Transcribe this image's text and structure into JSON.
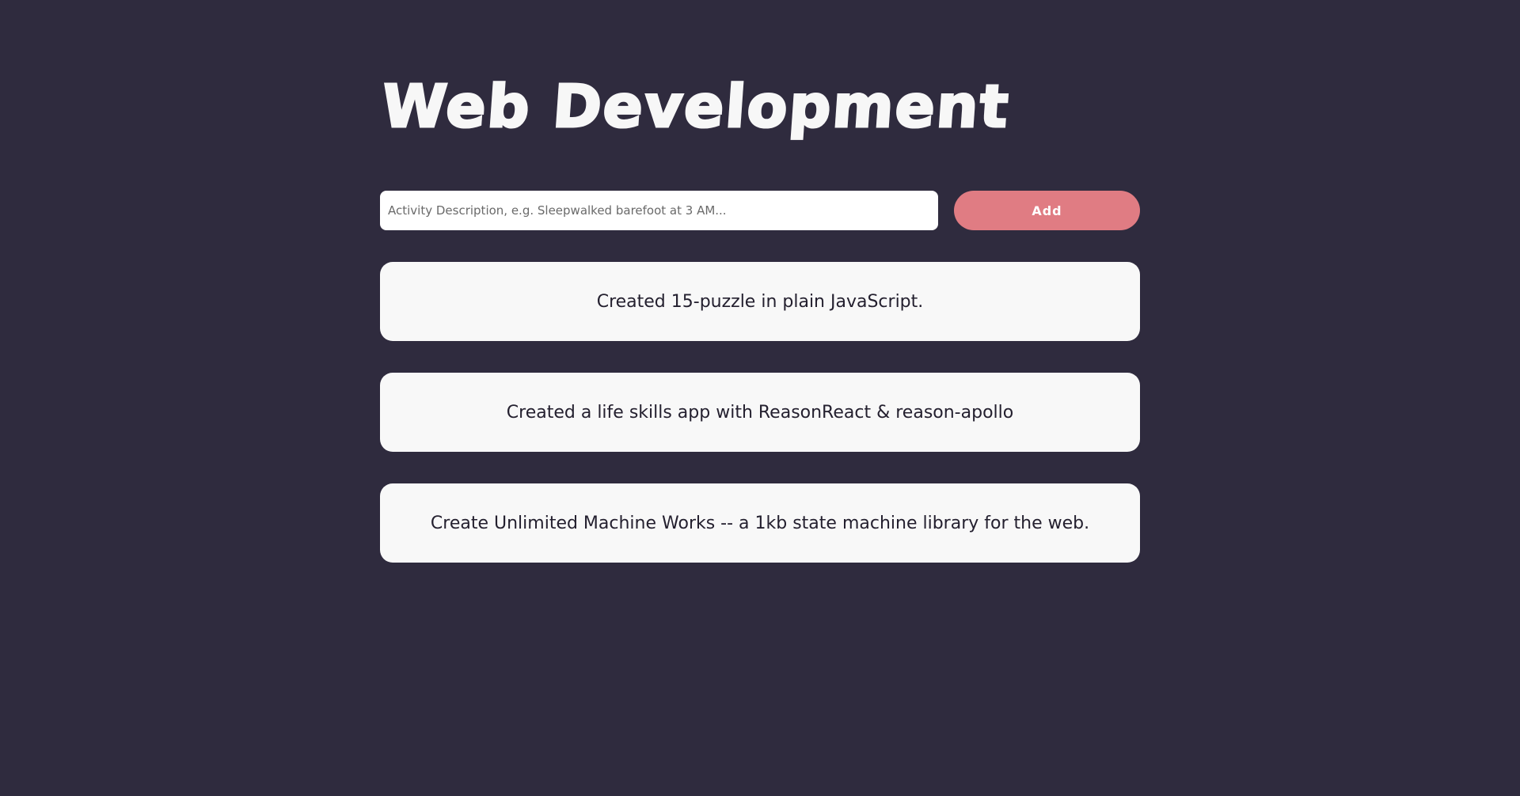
{
  "header": {
    "title": "Web Development"
  },
  "form": {
    "input_value": "",
    "input_placeholder": "Activity Description, e.g. Sleepwalked barefoot at 3 AM...",
    "add_label": "Add"
  },
  "activities": [
    {
      "text": "Created 15-puzzle in plain JavaScript."
    },
    {
      "text": "Created a life skills app with ReasonReact & reason-apollo"
    },
    {
      "text": "Create Unlimited Machine Works -- a 1kb state machine library for the web."
    }
  ],
  "colors": {
    "background": "#2f2b3e",
    "card": "#f8f8f8",
    "accent": "#e07c83",
    "title": "#f7f7f7"
  }
}
